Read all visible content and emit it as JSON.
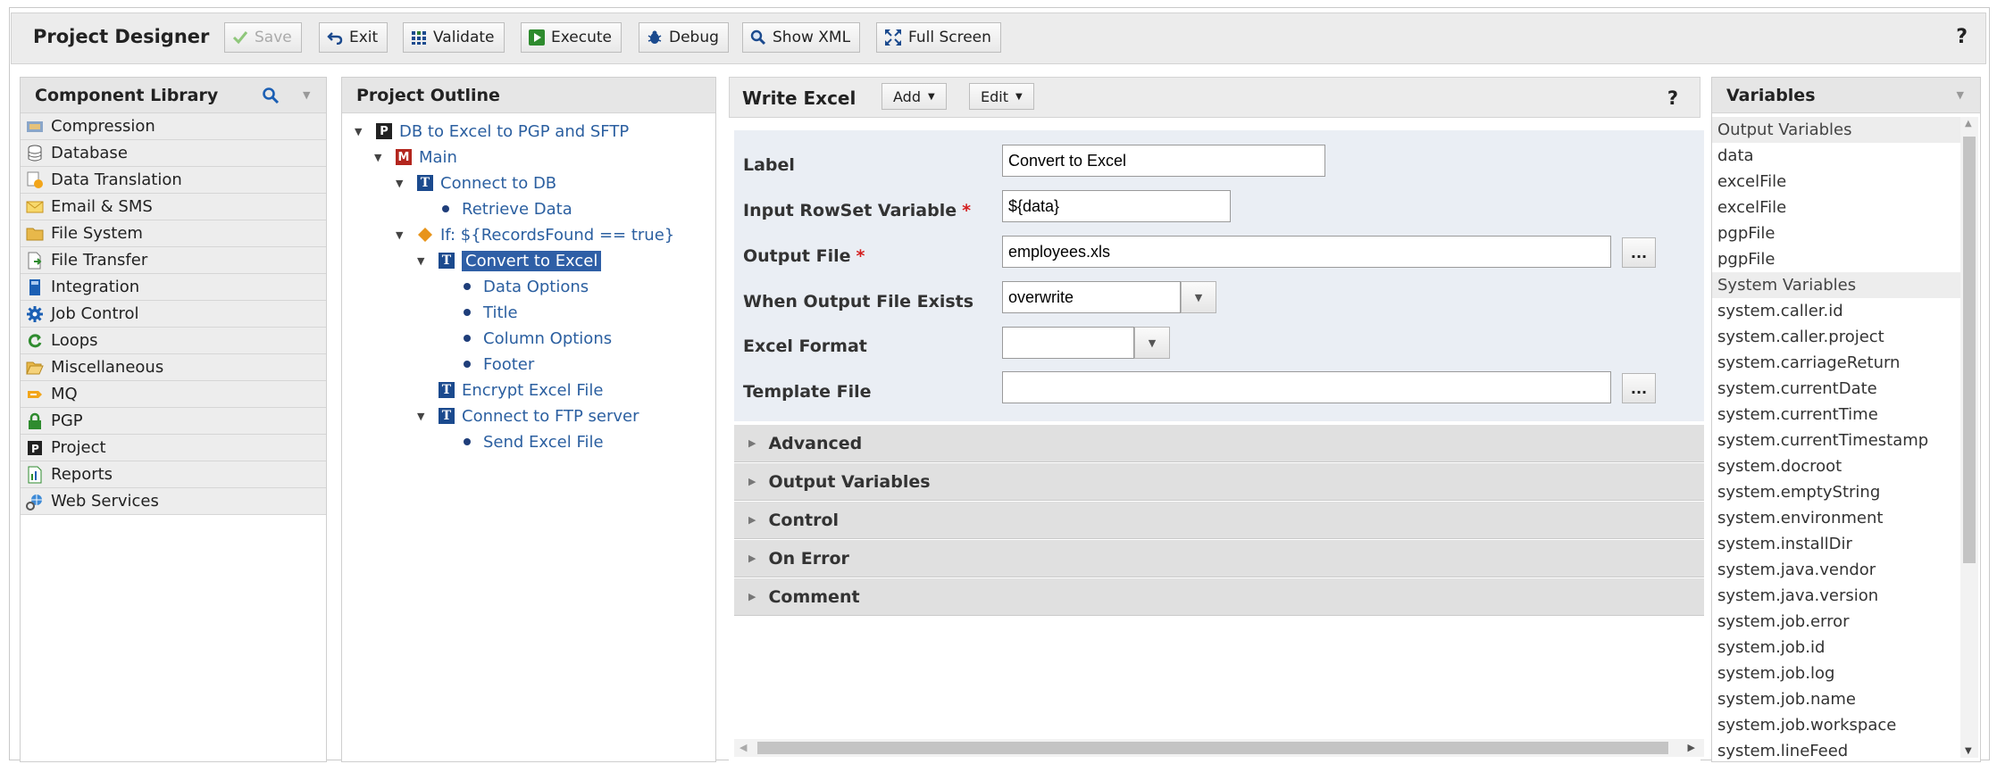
{
  "toolbar": {
    "title": "Project Designer",
    "buttons": {
      "save": "Save",
      "exit": "Exit",
      "validate": "Validate",
      "execute": "Execute",
      "debug": "Debug",
      "show_xml": "Show XML",
      "full_screen": "Full Screen"
    },
    "help": "?"
  },
  "library": {
    "title": "Component Library",
    "items": [
      {
        "label": "Compression",
        "icon": "compression-icon"
      },
      {
        "label": "Database",
        "icon": "database-icon"
      },
      {
        "label": "Data Translation",
        "icon": "data-translation-icon"
      },
      {
        "label": "Email & SMS",
        "icon": "email-icon"
      },
      {
        "label": "File System",
        "icon": "folder-icon"
      },
      {
        "label": "File Transfer",
        "icon": "file-transfer-icon"
      },
      {
        "label": "Integration",
        "icon": "integration-icon"
      },
      {
        "label": "Job Control",
        "icon": "gear-icon"
      },
      {
        "label": "Loops",
        "icon": "loop-icon"
      },
      {
        "label": "Miscellaneous",
        "icon": "folder-open-icon"
      },
      {
        "label": "MQ",
        "icon": "mq-icon"
      },
      {
        "label": "PGP",
        "icon": "lock-icon"
      },
      {
        "label": "Project",
        "icon": "project-icon"
      },
      {
        "label": "Reports",
        "icon": "report-icon"
      },
      {
        "label": "Web Services",
        "icon": "web-services-icon"
      }
    ]
  },
  "outline": {
    "title": "Project Outline",
    "nodes": [
      {
        "label": "DB to Excel to PGP and SFTP",
        "icon": "project-icon"
      },
      {
        "label": "Main",
        "icon": "module-icon"
      },
      {
        "label": "Connect to DB",
        "icon": "task-icon"
      },
      {
        "label": "Retrieve Data",
        "icon": "bullet-icon"
      },
      {
        "label": "If: ${RecordsFound == true}",
        "icon": "if-diamond-icon"
      },
      {
        "label": "Convert to Excel",
        "icon": "task-icon"
      },
      {
        "label": "Data Options",
        "icon": "bullet-icon"
      },
      {
        "label": "Title",
        "icon": "bullet-icon"
      },
      {
        "label": "Column Options",
        "icon": "bullet-icon"
      },
      {
        "label": "Footer",
        "icon": "bullet-icon"
      },
      {
        "label": "Encrypt Excel File",
        "icon": "task-icon"
      },
      {
        "label": "Connect to FTP server",
        "icon": "task-icon"
      },
      {
        "label": "Send Excel File",
        "icon": "bullet-icon"
      }
    ]
  },
  "editor": {
    "title": "Write Excel",
    "add_label": "Add",
    "edit_label": "Edit",
    "help": "?",
    "fields": {
      "label": {
        "label": "Label",
        "value": "Convert to Excel"
      },
      "input_rowset": {
        "label": "Input RowSet Variable",
        "value": "${data}",
        "required": "*"
      },
      "output_file": {
        "label": "Output File",
        "value": "employees.xls",
        "required": "*"
      },
      "when_exists": {
        "label": "When Output File Exists",
        "value": "overwrite"
      },
      "excel_format": {
        "label": "Excel Format",
        "value": ""
      },
      "template_file": {
        "label": "Template File",
        "value": ""
      }
    },
    "browse_label": "...",
    "sections": [
      "Advanced",
      "Output Variables",
      "Control",
      "On Error",
      "Comment"
    ]
  },
  "variables": {
    "title": "Variables",
    "output_group": "Output Variables",
    "output_items": [
      "data",
      "excelFile",
      "excelFile",
      "pgpFile",
      "pgpFile"
    ],
    "system_group": "System Variables",
    "system_items": [
      "system.caller.id",
      "system.caller.project",
      "system.carriageReturn",
      "system.currentDate",
      "system.currentTime",
      "system.currentTimestamp",
      "system.docroot",
      "system.emptyString",
      "system.environment",
      "system.installDir",
      "system.java.vendor",
      "system.java.version",
      "system.job.error",
      "system.job.id",
      "system.job.log",
      "system.job.name",
      "system.job.workspace",
      "system.lineFeed"
    ]
  },
  "colors": {
    "accent": "#2f5fa6",
    "link": "#2b5fa0",
    "required": "#d42020"
  }
}
